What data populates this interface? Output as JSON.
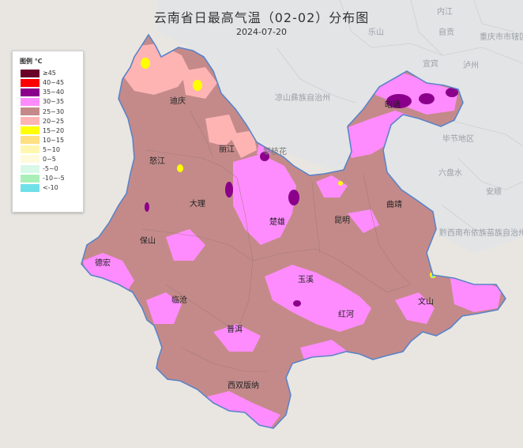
{
  "map": {
    "title": "云南省日最高气温（02-02）分布图",
    "date": "2024-07-20"
  },
  "legend": {
    "title": "图例 ℃",
    "items": [
      {
        "label": "≥45",
        "color": "#6a0028"
      },
      {
        "label": "40~45",
        "color": "#ff0000"
      },
      {
        "label": "35~40",
        "color": "#8b008b"
      },
      {
        "label": "30~35",
        "color": "#ff8cff"
      },
      {
        "label": "25~30",
        "color": "#c48a8a"
      },
      {
        "label": "20~25",
        "color": "#ffb4b4"
      },
      {
        "label": "15~20",
        "color": "#ffff00"
      },
      {
        "label": "10~15",
        "color": "#ffe080"
      },
      {
        "label": "5~10",
        "color": "#fff7b0"
      },
      {
        "label": "0~5",
        "color": "#fffadc"
      },
      {
        "label": "-5~0",
        "color": "#d8f8e8"
      },
      {
        "label": "-10~-5",
        "color": "#a8f0b8"
      },
      {
        "label": "<-10",
        "color": "#70e0e8"
      }
    ]
  },
  "background_labels": {
    "neijiang": "内江",
    "zigong": "自贡",
    "chongqing": "重庆市市辖区",
    "leshan": "乐山",
    "yibin": "宜宾",
    "luzhou": "泸州",
    "liangshan": "凉山彝族自治州",
    "bijie": "毕节地区",
    "liupanshui": "六盘水",
    "anshun": "安顺",
    "qianxinan": "黔西南布依族苗族自治州",
    "panzhihua": "攀枝花"
  },
  "cities": {
    "diqing": "迪庆",
    "lijiang": "丽江",
    "nujiang": "怒江",
    "zhaotong": "昭通",
    "dali": "大理",
    "chuxiong": "楚雄",
    "kunming": "昆明",
    "qujing": "曲靖",
    "baoshan": "保山",
    "dehong": "德宏",
    "lincang": "临沧",
    "yuxi": "玉溪",
    "honghe": "红河",
    "wenshan": "文山",
    "puer": "普洱",
    "xishuangbanna": "西双版纳"
  }
}
